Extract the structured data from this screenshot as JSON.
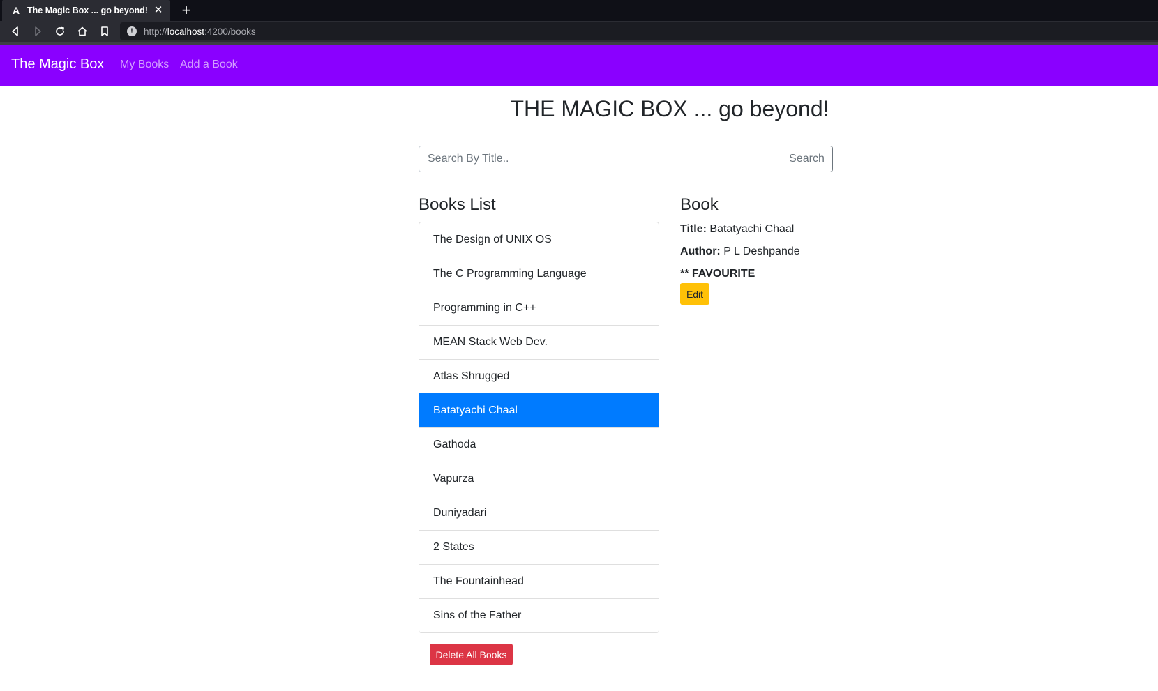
{
  "browser": {
    "tab_favicon": "A",
    "tab_title": "The Magic Box ... go beyond!",
    "close_glyph": "✕",
    "new_tab_glyph": "+",
    "url_scheme": "http://",
    "url_host": "localhost",
    "url_path": ":4200/books",
    "info_glyph": "!"
  },
  "navbar": {
    "brand": "The Magic Box",
    "links": [
      "My Books",
      "Add a Book"
    ],
    "color": "#8a00ff"
  },
  "page": {
    "title": "THE MAGIC BOX ... go beyond!"
  },
  "search": {
    "placeholder": "Search By Title..",
    "button_label": "Search"
  },
  "books_list": {
    "heading": "Books List",
    "items": [
      "The Design of UNIX OS",
      "The C Programming Language",
      "Programming in C++",
      "MEAN Stack Web Dev.",
      "Atlas Shrugged",
      "Batatyachi Chaal",
      "Gathoda",
      "Vapurza",
      "Duniyadari",
      "2 States",
      "The Fountainhead",
      "Sins of the Father"
    ],
    "active_item": "Batatyachi Chaal",
    "active_color": "#007bff",
    "delete_label": "Delete All Books"
  },
  "book_detail": {
    "heading": "Book",
    "title_label": "Title:",
    "title_value": "Batatyachi Chaal",
    "author_label": "Author:",
    "author_value": "P L Deshpande",
    "favourite": "** FAVOURITE",
    "edit_label": "Edit"
  }
}
